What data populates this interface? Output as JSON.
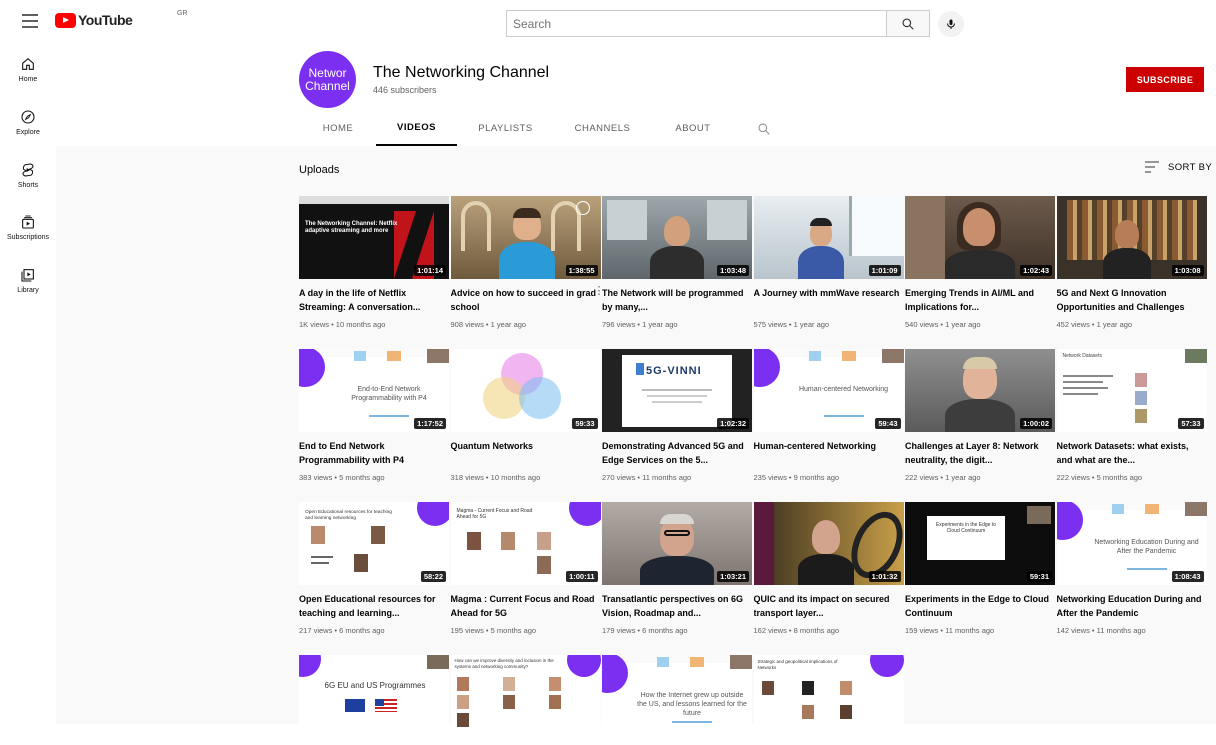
{
  "topbar": {
    "logo_text": "YouTube",
    "logo_region": "GR",
    "search_placeholder": "Search"
  },
  "sidebar": {
    "items": [
      {
        "label": "Home",
        "icon": "home-icon"
      },
      {
        "label": "Explore",
        "icon": "compass-icon"
      },
      {
        "label": "Shorts",
        "icon": "shorts-icon"
      },
      {
        "label": "Subscriptions",
        "icon": "subscriptions-icon"
      },
      {
        "label": "Library",
        "icon": "library-icon"
      }
    ]
  },
  "channel": {
    "avatar_line1": "Networ",
    "avatar_line2": "Channel",
    "title": "The Networking Channel",
    "subscribers": "446 subscribers",
    "subscribe_label": "SUBSCRIBE",
    "avatar_color": "#7b2ff0",
    "subscribe_color": "#cc0000",
    "tabs": [
      "HOME",
      "VIDEOS",
      "PLAYLISTS",
      "CHANNELS",
      "ABOUT"
    ],
    "active_tab": "VIDEOS"
  },
  "uploads": {
    "heading": "Uploads",
    "sort_label": "SORT BY"
  },
  "videos": [
    {
      "title": "A day in the life of Netflix Streaming: A conversation...",
      "meta": "1K views • 10 months ago",
      "duration": "1:01:14",
      "thumb": "netflix",
      "thumb_text": "The Networking Channel: Netflix adaptive streaming and more"
    },
    {
      "title": "Advice on how to succeed in grad school",
      "meta": "908 views • 1 year ago",
      "duration": "1:38:55",
      "thumb": "arches"
    },
    {
      "title": "The Network will be programmed by many,...",
      "meta": "796 views • 1 year ago",
      "duration": "1:03:48",
      "thumb": "office"
    },
    {
      "title": "A Journey with mmWave research",
      "meta": "575 views • 1 year ago",
      "duration": "1:01:09",
      "thumb": "window"
    },
    {
      "title": "Emerging Trends in AI/ML and Implications for...",
      "meta": "540 views • 1 year ago",
      "duration": "1:02:43",
      "thumb": "woman"
    },
    {
      "title": "5G and Next G Innovation Opportunities and Challenges",
      "meta": "452 views • 1 year ago",
      "duration": "1:03:08",
      "thumb": "bookshelf"
    },
    {
      "title": "End to End Network Programmability with P4",
      "meta": "383 views • 5 months ago",
      "duration": "1:17:52",
      "thumb": "slide",
      "thumb_text": "End-to-End Network Programmability with P4"
    },
    {
      "title": "Quantum Networks",
      "meta": "318 views • 10 months ago",
      "duration": "59:33",
      "thumb": "venn"
    },
    {
      "title": "Demonstrating Advanced 5G and Edge Services on the 5...",
      "meta": "270 views • 11 months ago",
      "duration": "1:02:32",
      "thumb": "5gvinni",
      "thumb_text": "5G-VINNI"
    },
    {
      "title": "Human-centered Networking",
      "meta": "235 views • 9 months ago",
      "duration": "59:43",
      "thumb": "slide",
      "thumb_text": "Human-centered Networking"
    },
    {
      "title": "Challenges at Layer 8: Network neutrality, the digit...",
      "meta": "222 views • 1 year ago",
      "duration": "1:00:02",
      "thumb": "man-grey"
    },
    {
      "title": "Network Datasets: what exists, and what are the...",
      "meta": "222 views • 5 months ago",
      "duration": "57:33",
      "thumb": "datasets",
      "thumb_text": "Network Datasets"
    },
    {
      "title": "Open Educational resources for teaching and learning...",
      "meta": "217 views • 6 months ago",
      "duration": "58:22",
      "thumb": "panel",
      "thumb_text": "Open Educational resources for teaching and learning networking"
    },
    {
      "title": "Magma : Current Focus and Road Ahead for 5G",
      "meta": "195 views • 5 months ago",
      "duration": "1:00:11",
      "thumb": "panel2",
      "thumb_text": "Magma - Current Focus and Road Ahead for 5G"
    },
    {
      "title": "Transatlantic perspectives on 6G Vision, Roadmap and...",
      "meta": "179 views • 6 months ago",
      "duration": "1:03:21",
      "thumb": "oldman"
    },
    {
      "title": "QUIC and its impact on secured transport layer...",
      "meta": "162 views • 8 months ago",
      "duration": "1:01:32",
      "thumb": "quic"
    },
    {
      "title": "Experiments in the Edge to Cloud Continuum",
      "meta": "159 views • 11 months ago",
      "duration": "59:31",
      "thumb": "edge",
      "thumb_text": "Experiments in the Edge to Cloud Continuum"
    },
    {
      "title": "Networking Education During and After the Pandemic",
      "meta": "142 views • 11 months ago",
      "duration": "1:08:43",
      "thumb": "slide",
      "thumb_text": "Networking Education During and After the Pandemic"
    },
    {
      "title": "",
      "meta": "",
      "duration": "",
      "thumb": "eu",
      "thumb_text": "6G EU and US Programmes"
    },
    {
      "title": "",
      "meta": "",
      "duration": "",
      "thumb": "diversity",
      "thumb_text": "How can we improve diversity and inclusion in the systems and networking community?"
    },
    {
      "title": "",
      "meta": "",
      "duration": "",
      "thumb": "slide",
      "thumb_text": "How the Internet grew up outside the US, and lessons learned for the future"
    },
    {
      "title": "",
      "meta": "",
      "duration": "",
      "thumb": "geo",
      "thumb_text": "Strategic and geopolitical implications of Networks"
    }
  ]
}
